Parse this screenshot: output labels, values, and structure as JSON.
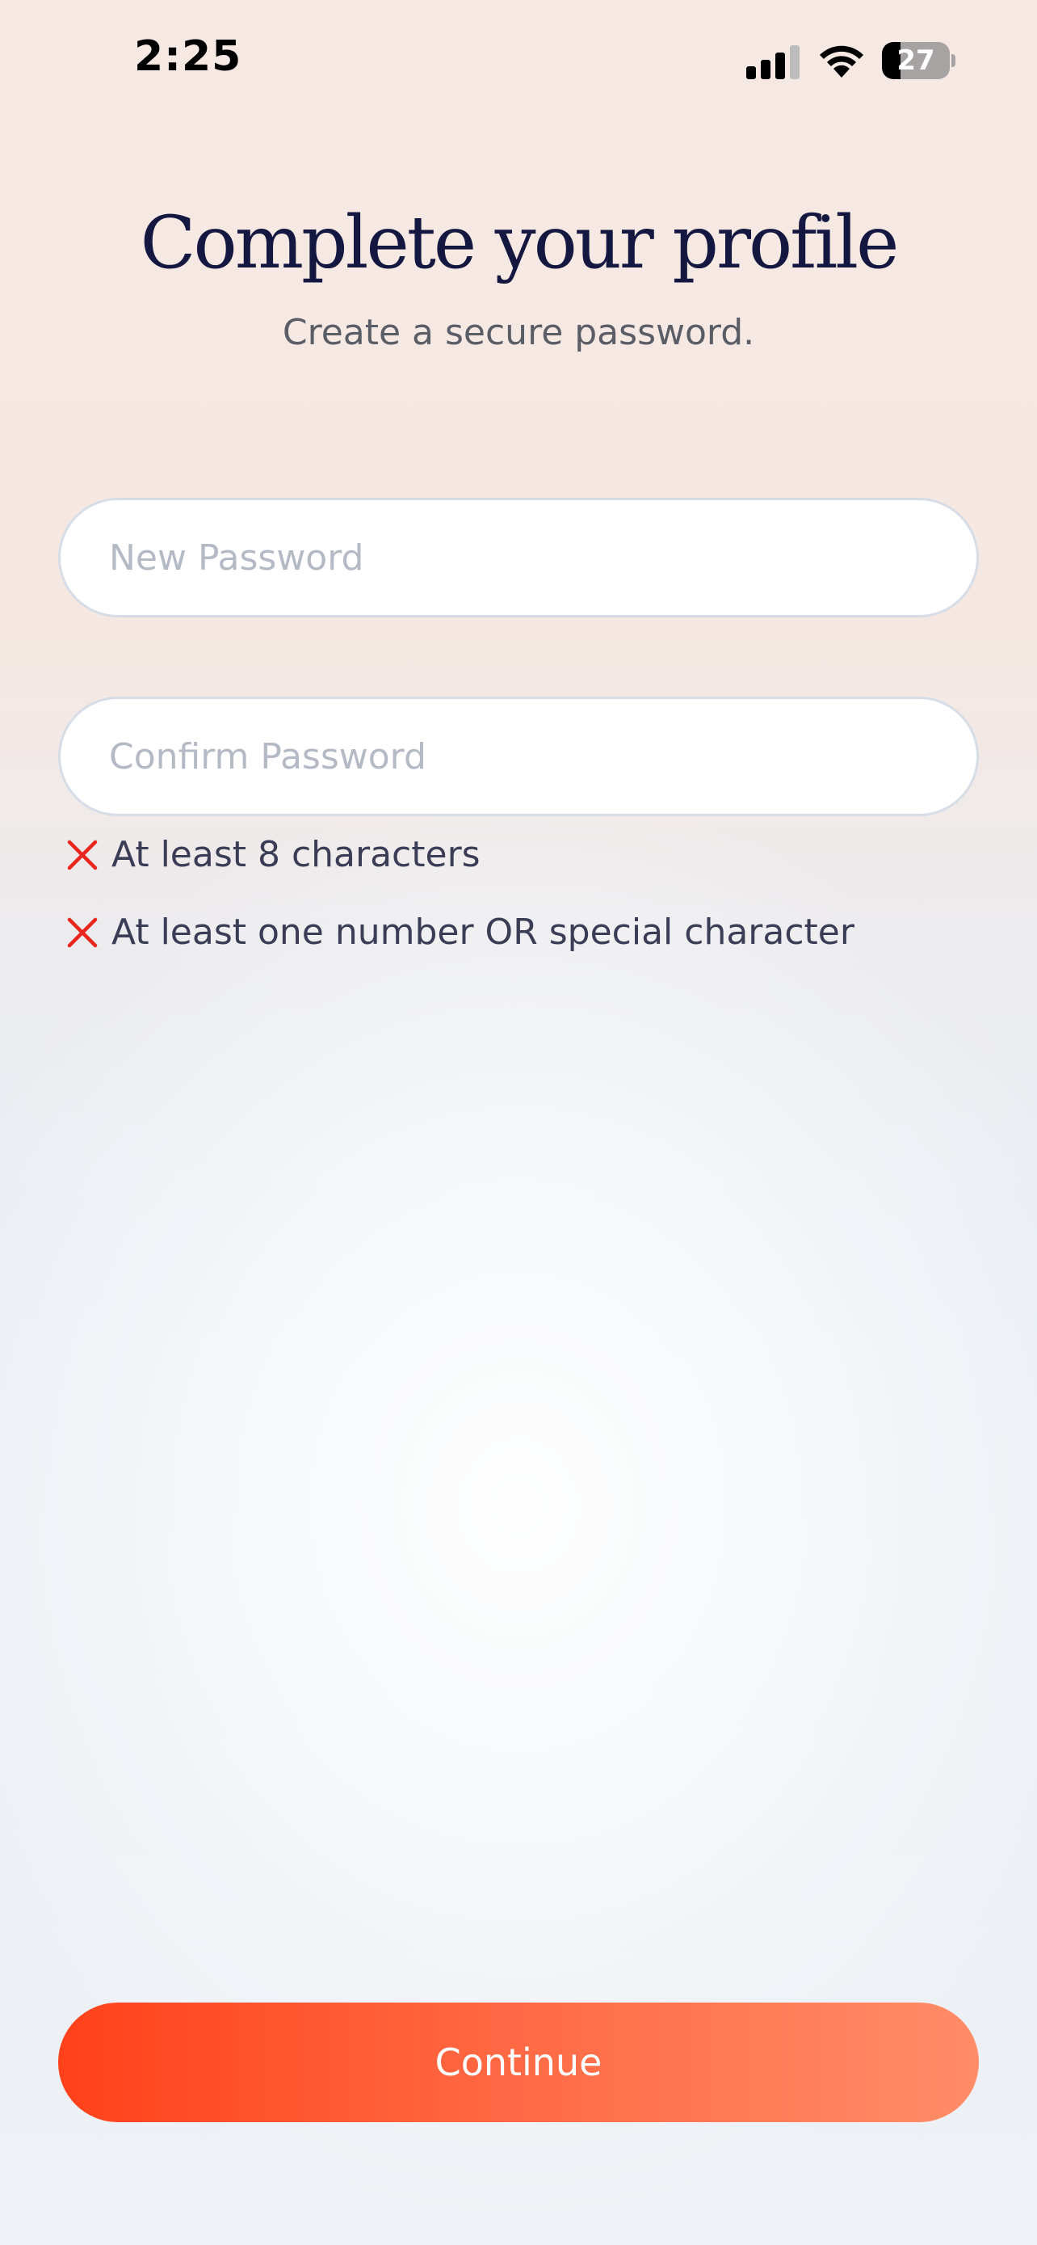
{
  "status_bar": {
    "time": "2:25",
    "battery_level": "27",
    "battery_fraction": 0.27,
    "icons": [
      "signal-icon",
      "wifi-icon",
      "battery-icon"
    ]
  },
  "header": {
    "title": "Complete your profile",
    "subtitle": "Create a secure password."
  },
  "form": {
    "new_password": {
      "value": "",
      "placeholder": "New Password"
    },
    "confirm_password": {
      "value": "",
      "placeholder": "Confirm Password"
    }
  },
  "requirements": [
    {
      "label": "At least 8 characters",
      "met": false,
      "icon": "x-icon"
    },
    {
      "label": "At least one number OR special character",
      "met": false,
      "icon": "x-icon"
    }
  ],
  "footer": {
    "continue_label": "Continue"
  },
  "colors": {
    "title": "#14173f",
    "error": "#e8261e",
    "button_start": "#ff411b",
    "button_end": "#ff8d68"
  }
}
